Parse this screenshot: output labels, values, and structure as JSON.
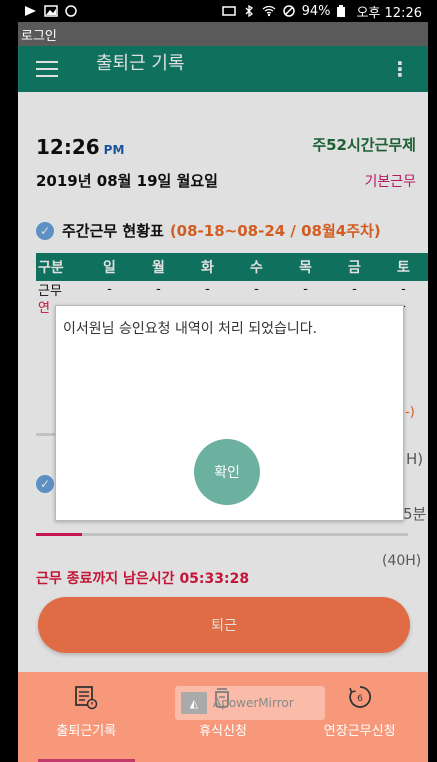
{
  "status_bar": {
    "battery": "94%",
    "time": "오후 12:26"
  },
  "login_bar": {
    "label": "로그인"
  },
  "app_bar": {
    "title": "출퇴근 기록",
    "more": "⋮"
  },
  "summary": {
    "time": "12:26",
    "ampm": "PM",
    "work_rule": "주52시간근무제",
    "date": "2019년 08월 19일 월요일",
    "work_type": "기본근무"
  },
  "weekly": {
    "title": "주간근무 현황표",
    "range": "(08-18~08-24 / 08월4주차)",
    "headers": [
      "구분",
      "일",
      "월",
      "화",
      "수",
      "목",
      "금",
      "토"
    ],
    "rows": [
      {
        "label": "근무",
        "values": [
          "-",
          "-",
          "-",
          "-",
          "-",
          "-",
          "-"
        ]
      },
      {
        "label": "연",
        "values": [
          "",
          "",
          "",
          "",
          "",
          "",
          "-"
        ]
      }
    ]
  },
  "side_values": {
    "minus": "(-)",
    "hours": "H)",
    "minutes": "5분",
    "total": "(40H)"
  },
  "remaining": {
    "label": "근무 종료까지 남은시간",
    "value": "05:33:28"
  },
  "checkout_button": "퇴근",
  "dialog": {
    "message": "이서원님 승인요청 내역이 처리 되었습니다.",
    "ok": "확인"
  },
  "tabs": [
    {
      "label": "출퇴근기록",
      "icon": "record-icon",
      "active": true
    },
    {
      "label": "휴식신청",
      "icon": "coffee-icon",
      "active": false
    },
    {
      "label": "연장근무신청",
      "icon": "timer-icon",
      "active": false
    }
  ],
  "watermark": {
    "text": "ApowerMirror"
  },
  "colors": {
    "primary": "#12806a",
    "accent": "#ff7b4f",
    "tab_bar": "#f7987a",
    "alert": "#e0183f"
  }
}
